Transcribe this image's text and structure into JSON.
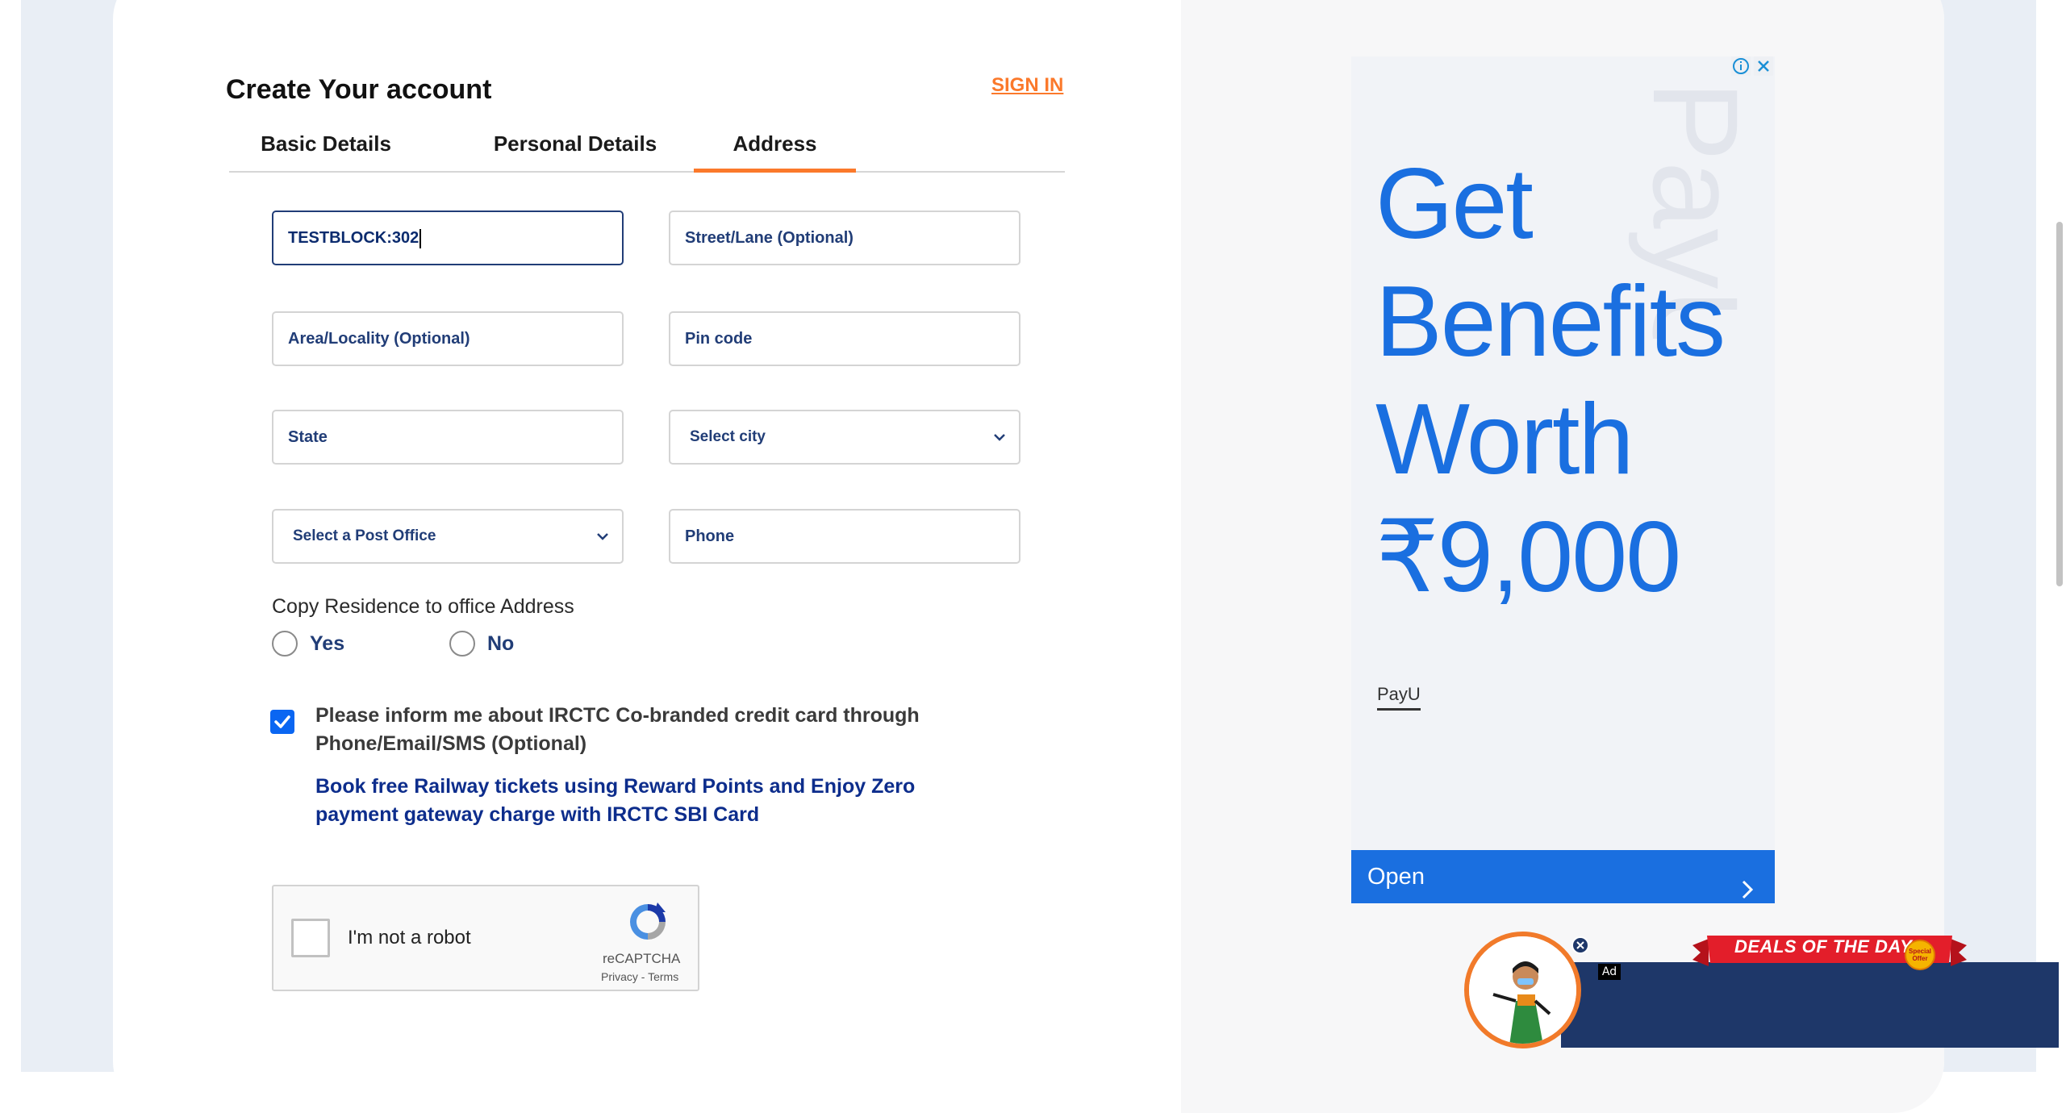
{
  "form": {
    "title": "Create Your account",
    "sign_in": "SIGN IN",
    "tabs": [
      {
        "label": "Basic Details"
      },
      {
        "label": "Personal Details"
      },
      {
        "label": "Address",
        "active": true
      }
    ],
    "fields": {
      "address_value": "TESTBLOCK:302",
      "street_placeholder": "Street/Lane (Optional)",
      "area_placeholder": "Area/Locality (Optional)",
      "pin_placeholder": "Pin code",
      "state_placeholder": "State",
      "city_select": "Select city",
      "post_office_select": "Select a Post Office",
      "phone_placeholder": "Phone"
    },
    "copy_address": {
      "label": "Copy Residence to office Address",
      "yes": "Yes",
      "no": "No"
    },
    "inform": {
      "checked": true,
      "text": "Please inform me about IRCTC Co-branded credit card through Phone/Email/SMS (Optional)",
      "promo": "Book free Railway tickets using Reward Points and Enjoy Zero payment gateway charge with IRCTC SBI Card"
    },
    "recaptcha": {
      "label": "I'm not a robot",
      "brand": "reCAPTCHA",
      "links": "Privacy - Terms"
    }
  },
  "ad": {
    "headline_lines": [
      "Get",
      "Benefits",
      "Worth",
      "₹9,000"
    ],
    "watermark": "PayU",
    "brand": "PayU",
    "open_label": "Open",
    "accent_color": "#1a6fe0"
  },
  "deals": {
    "title": "DEALS OF THE DAY",
    "badge": "Ad",
    "sticker": "Special Offer"
  },
  "colors": {
    "primary_navy": "#213d77",
    "orange": "#fb792b",
    "deals_bg": "#1e3769"
  }
}
